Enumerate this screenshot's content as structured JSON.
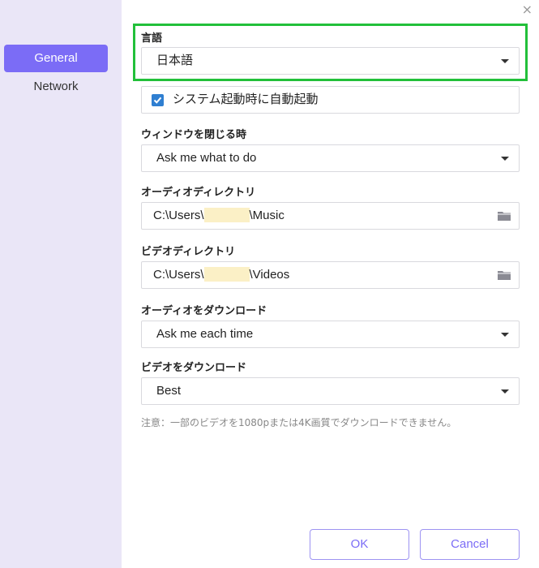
{
  "sidebar": {
    "items": [
      {
        "label": "General",
        "active": true
      },
      {
        "label": "Network",
        "active": false
      }
    ]
  },
  "window": {
    "close_glyph": "×"
  },
  "settings": {
    "language": {
      "label": "言語",
      "value": "日本語"
    },
    "autostart": {
      "label": "システム起動時に自動起動",
      "checked": true
    },
    "on_close": {
      "label": "ウィンドウを閉じる時",
      "value": "Ask me what to do"
    },
    "audio_dir": {
      "label": "オーディオディレクトリ",
      "prefix": "C:\\Users\\",
      "suffix": "\\Music",
      "icon": "folder-icon"
    },
    "video_dir": {
      "label": "ビデオディレクトリ",
      "prefix": "C:\\Users\\",
      "suffix": "\\Videos",
      "icon": "folder-icon"
    },
    "audio_download": {
      "label": "オーディオをダウンロード",
      "value": "Ask me each time"
    },
    "video_download": {
      "label": "ビデオをダウンロード",
      "value": "Best"
    }
  },
  "note": "注意：一部のビデオを1080pまたは4K画質でダウンロードできません。",
  "buttons": {
    "ok": "OK",
    "cancel": "Cancel"
  },
  "colors": {
    "accent": "#7b6cf6",
    "sidebar_bg": "#eae6f7",
    "highlight": "#22c03a",
    "checkbox": "#2f7fd1"
  }
}
